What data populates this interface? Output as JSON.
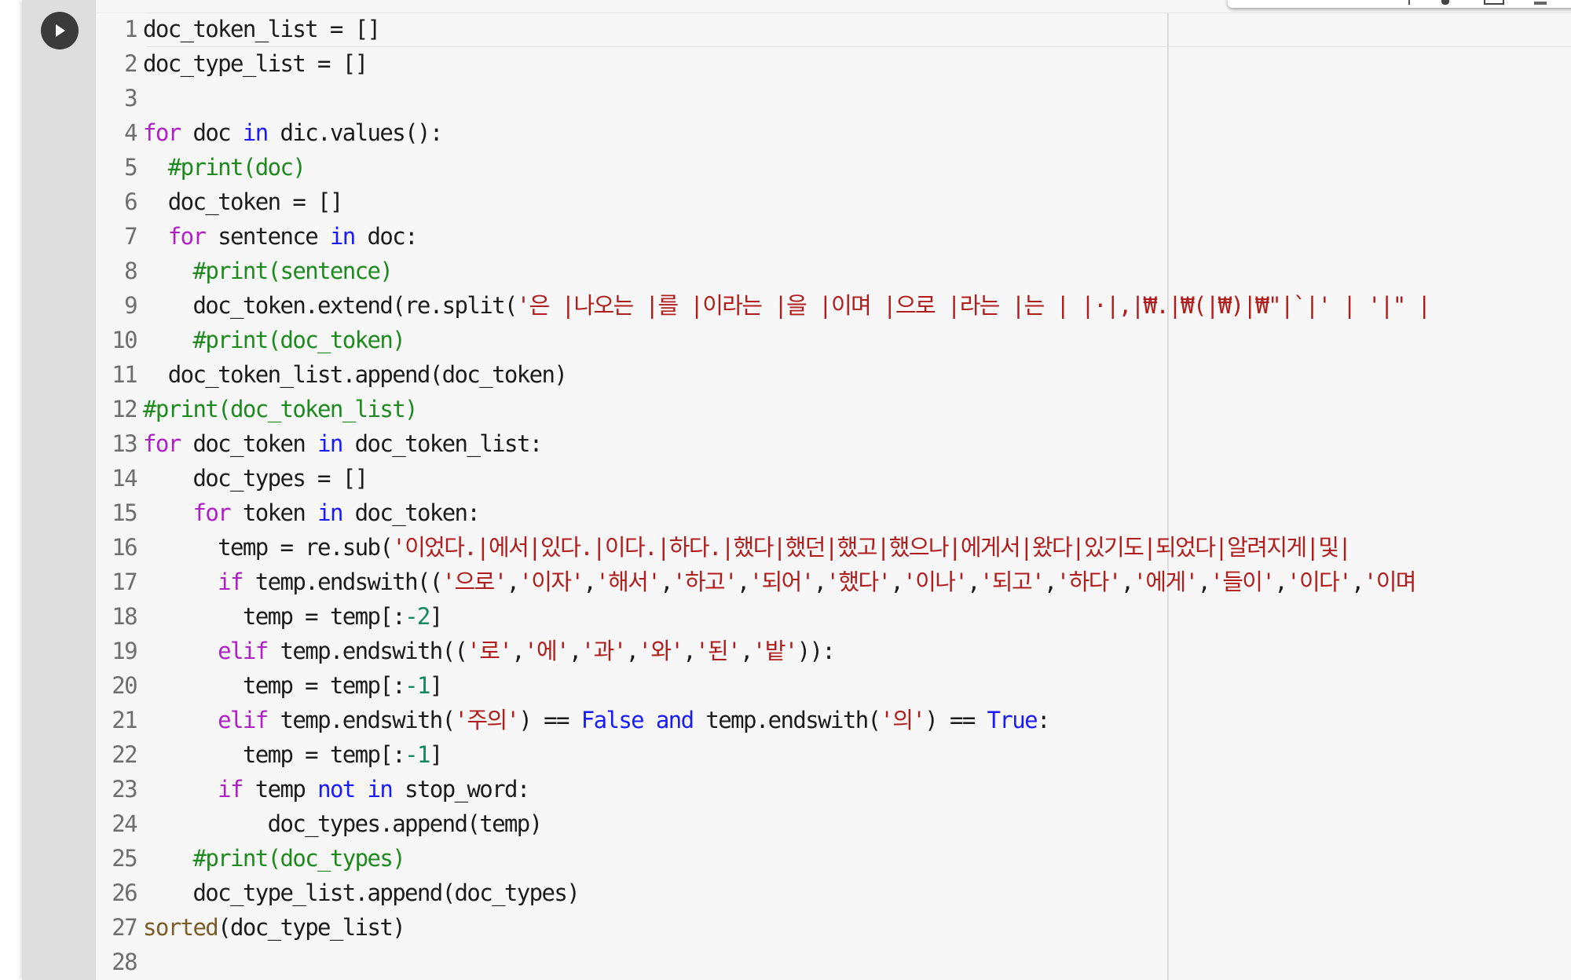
{
  "cell": {
    "run_button_label": "Run cell",
    "toolbar_icons": [
      "arrow-up-icon",
      "link-icon",
      "comment-icon",
      "settings-icon"
    ]
  },
  "colors": {
    "keyword": "#b01fc6",
    "builtin_keyword": "#1a1aff",
    "string": "#b11c1c",
    "comment": "#1c8a1c",
    "number": "#118862",
    "function": "#7b5b26"
  },
  "code_lines": [
    {
      "n": "1",
      "tokens": [
        {
          "t": "doc_token_list = []",
          "c": "code"
        }
      ]
    },
    {
      "n": "2",
      "tokens": [
        {
          "t": "doc_type_list = []",
          "c": "code"
        }
      ]
    },
    {
      "n": "3",
      "tokens": [
        {
          "t": "",
          "c": "code"
        }
      ]
    },
    {
      "n": "4",
      "tokens": [
        {
          "t": "for",
          "c": "kw"
        },
        {
          "t": " doc ",
          "c": "code"
        },
        {
          "t": "in",
          "c": "kw2"
        },
        {
          "t": " dic.values():",
          "c": "code"
        }
      ]
    },
    {
      "n": "5",
      "tokens": [
        {
          "t": "  ",
          "c": "code"
        },
        {
          "t": "#print(doc)",
          "c": "com"
        }
      ]
    },
    {
      "n": "6",
      "tokens": [
        {
          "t": "  doc_token = []",
          "c": "code"
        }
      ]
    },
    {
      "n": "7",
      "tokens": [
        {
          "t": "  ",
          "c": "code"
        },
        {
          "t": "for",
          "c": "kw"
        },
        {
          "t": " sentence ",
          "c": "code"
        },
        {
          "t": "in",
          "c": "kw2"
        },
        {
          "t": " doc:",
          "c": "code"
        }
      ]
    },
    {
      "n": "8",
      "tokens": [
        {
          "t": "    ",
          "c": "code"
        },
        {
          "t": "#print(sentence)",
          "c": "com"
        }
      ]
    },
    {
      "n": "9",
      "tokens": [
        {
          "t": "    doc_token.extend(re.split(",
          "c": "code"
        },
        {
          "t": "'은 |나오는 |를 |이라는 |을 |이며 |으로 |라는 |는 | |·|,|₩.|₩(|₩)|₩\"|`|' | '|\" |",
          "c": "str"
        }
      ]
    },
    {
      "n": "10",
      "tokens": [
        {
          "t": "    ",
          "c": "code"
        },
        {
          "t": "#print(doc_token)",
          "c": "com"
        }
      ]
    },
    {
      "n": "11",
      "tokens": [
        {
          "t": "  doc_token_list.append(doc_token)",
          "c": "code"
        }
      ]
    },
    {
      "n": "12",
      "tokens": [
        {
          "t": "#print(doc_token_list)",
          "c": "com"
        }
      ]
    },
    {
      "n": "13",
      "tokens": [
        {
          "t": "for",
          "c": "kw"
        },
        {
          "t": " doc_token ",
          "c": "code"
        },
        {
          "t": "in",
          "c": "kw2"
        },
        {
          "t": " doc_token_list:",
          "c": "code"
        }
      ]
    },
    {
      "n": "14",
      "tokens": [
        {
          "t": "    doc_types = []",
          "c": "code"
        }
      ]
    },
    {
      "n": "15",
      "tokens": [
        {
          "t": "    ",
          "c": "code"
        },
        {
          "t": "for",
          "c": "kw"
        },
        {
          "t": " token ",
          "c": "code"
        },
        {
          "t": "in",
          "c": "kw2"
        },
        {
          "t": " doc_token:",
          "c": "code"
        }
      ]
    },
    {
      "n": "16",
      "tokens": [
        {
          "t": "      temp = re.sub(",
          "c": "code"
        },
        {
          "t": "'이었다.|에서|있다.|이다.|하다.|했다|했던|했고|했으나|에게서|왔다|있기도|되었다|알려지게|및|",
          "c": "str"
        }
      ]
    },
    {
      "n": "17",
      "tokens": [
        {
          "t": "      ",
          "c": "code"
        },
        {
          "t": "if",
          "c": "kw"
        },
        {
          "t": " temp.endswith((",
          "c": "code"
        },
        {
          "t": "'으로'",
          "c": "str"
        },
        {
          "t": ",",
          "c": "code"
        },
        {
          "t": "'이자'",
          "c": "str"
        },
        {
          "t": ",",
          "c": "code"
        },
        {
          "t": "'해서'",
          "c": "str"
        },
        {
          "t": ",",
          "c": "code"
        },
        {
          "t": "'하고'",
          "c": "str"
        },
        {
          "t": ",",
          "c": "code"
        },
        {
          "t": "'되어'",
          "c": "str"
        },
        {
          "t": ",",
          "c": "code"
        },
        {
          "t": "'했다'",
          "c": "str"
        },
        {
          "t": ",",
          "c": "code"
        },
        {
          "t": "'이나'",
          "c": "str"
        },
        {
          "t": ",",
          "c": "code"
        },
        {
          "t": "'되고'",
          "c": "str"
        },
        {
          "t": ",",
          "c": "code"
        },
        {
          "t": "'하다'",
          "c": "str"
        },
        {
          "t": ",",
          "c": "code"
        },
        {
          "t": "'에게'",
          "c": "str"
        },
        {
          "t": ",",
          "c": "code"
        },
        {
          "t": "'들이'",
          "c": "str"
        },
        {
          "t": ",",
          "c": "code"
        },
        {
          "t": "'이다'",
          "c": "str"
        },
        {
          "t": ",",
          "c": "code"
        },
        {
          "t": "'이며",
          "c": "str"
        }
      ]
    },
    {
      "n": "18",
      "tokens": [
        {
          "t": "        temp = temp[:",
          "c": "code"
        },
        {
          "t": "-2",
          "c": "num"
        },
        {
          "t": "]",
          "c": "code"
        }
      ]
    },
    {
      "n": "19",
      "tokens": [
        {
          "t": "      ",
          "c": "code"
        },
        {
          "t": "elif",
          "c": "kw"
        },
        {
          "t": " temp.endswith((",
          "c": "code"
        },
        {
          "t": "'로'",
          "c": "str"
        },
        {
          "t": ",",
          "c": "code"
        },
        {
          "t": "'에'",
          "c": "str"
        },
        {
          "t": ",",
          "c": "code"
        },
        {
          "t": "'과'",
          "c": "str"
        },
        {
          "t": ",",
          "c": "code"
        },
        {
          "t": "'와'",
          "c": "str"
        },
        {
          "t": ",",
          "c": "code"
        },
        {
          "t": "'된'",
          "c": "str"
        },
        {
          "t": ",",
          "c": "code"
        },
        {
          "t": "'밭'",
          "c": "str"
        },
        {
          "t": ")):",
          "c": "code"
        }
      ]
    },
    {
      "n": "20",
      "tokens": [
        {
          "t": "        temp = temp[:",
          "c": "code"
        },
        {
          "t": "-1",
          "c": "num"
        },
        {
          "t": "]",
          "c": "code"
        }
      ]
    },
    {
      "n": "21",
      "tokens": [
        {
          "t": "      ",
          "c": "code"
        },
        {
          "t": "elif",
          "c": "kw"
        },
        {
          "t": " temp.endswith(",
          "c": "code"
        },
        {
          "t": "'주의'",
          "c": "str"
        },
        {
          "t": ") == ",
          "c": "code"
        },
        {
          "t": "False",
          "c": "kw2"
        },
        {
          "t": " ",
          "c": "code"
        },
        {
          "t": "and",
          "c": "kw2"
        },
        {
          "t": " temp.endswith(",
          "c": "code"
        },
        {
          "t": "'의'",
          "c": "str"
        },
        {
          "t": ") == ",
          "c": "code"
        },
        {
          "t": "True",
          "c": "kw2"
        },
        {
          "t": ":",
          "c": "code"
        }
      ]
    },
    {
      "n": "22",
      "tokens": [
        {
          "t": "        temp = temp[:",
          "c": "code"
        },
        {
          "t": "-1",
          "c": "num"
        },
        {
          "t": "]",
          "c": "code"
        }
      ]
    },
    {
      "n": "23",
      "tokens": [
        {
          "t": "      ",
          "c": "code"
        },
        {
          "t": "if",
          "c": "kw"
        },
        {
          "t": " temp ",
          "c": "code"
        },
        {
          "t": "not",
          "c": "kw2"
        },
        {
          "t": " ",
          "c": "code"
        },
        {
          "t": "in",
          "c": "kw2"
        },
        {
          "t": " stop_word:",
          "c": "code"
        }
      ]
    },
    {
      "n": "24",
      "tokens": [
        {
          "t": "          doc_types.append(temp)",
          "c": "code"
        }
      ]
    },
    {
      "n": "25",
      "tokens": [
        {
          "t": "    ",
          "c": "code"
        },
        {
          "t": "#print(doc_types)",
          "c": "com"
        }
      ]
    },
    {
      "n": "26",
      "tokens": [
        {
          "t": "    doc_type_list.append(doc_types)",
          "c": "code"
        }
      ]
    },
    {
      "n": "27",
      "tokens": [
        {
          "t": "sorted",
          "c": "bi"
        },
        {
          "t": "(doc_type_list)",
          "c": "code"
        }
      ]
    },
    {
      "n": "28",
      "tokens": [
        {
          "t": "",
          "c": "code"
        }
      ]
    }
  ]
}
